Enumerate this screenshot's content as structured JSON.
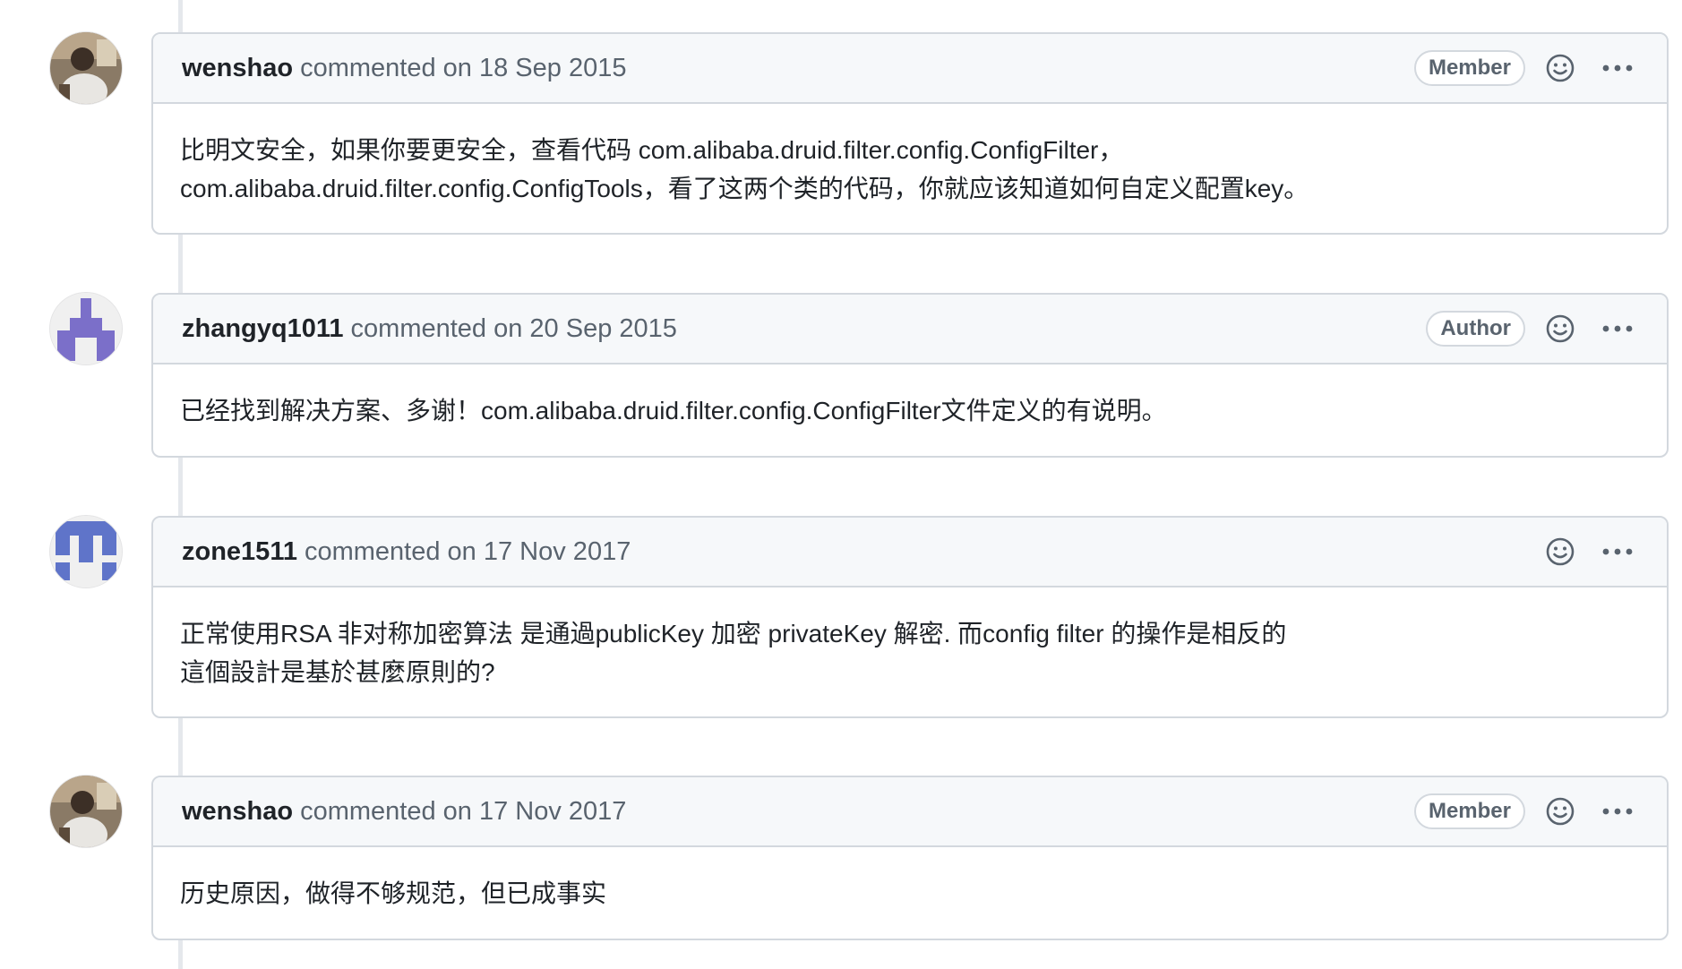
{
  "comments": [
    {
      "author": "wenshao",
      "meta": "commented on 18 Sep 2015",
      "badge": "Member",
      "avatar_icon": "photo-avatar",
      "lines": [
        "比明文安全，如果你要更安全，查看代码 com.alibaba.druid.filter.config.ConfigFilter，",
        "com.alibaba.druid.filter.config.ConfigTools，看了这两个类的代码，你就应该知道如何自定义配置key。"
      ]
    },
    {
      "author": "zhangyq1011",
      "meta": "commented on 20 Sep 2015",
      "badge": "Author",
      "avatar_icon": "identicon-avatar",
      "lines": [
        "已经找到解决方案、多谢！com.alibaba.druid.filter.config.ConfigFilter文件定义的有说明。"
      ]
    },
    {
      "author": "zone1511",
      "meta": "commented on 17 Nov 2017",
      "badge": "",
      "avatar_icon": "identicon-avatar",
      "lines": [
        "正常使用RSA 非对称加密算法 是通過publicKey 加密 privateKey 解密. 而config filter 的操作是相反的",
        "這個設計是基於甚麼原則的?"
      ]
    },
    {
      "author": "wenshao",
      "meta": "commented on 17 Nov 2017",
      "badge": "Member",
      "avatar_icon": "photo-avatar",
      "lines": [
        "历史原因，做得不够规范，但已成事实"
      ]
    }
  ],
  "colors": {
    "identicon_purple": "#7b6fc9",
    "identicon_blue": "#5f74c9",
    "header_bg": "#f6f8fa",
    "border": "#d3d8de"
  }
}
